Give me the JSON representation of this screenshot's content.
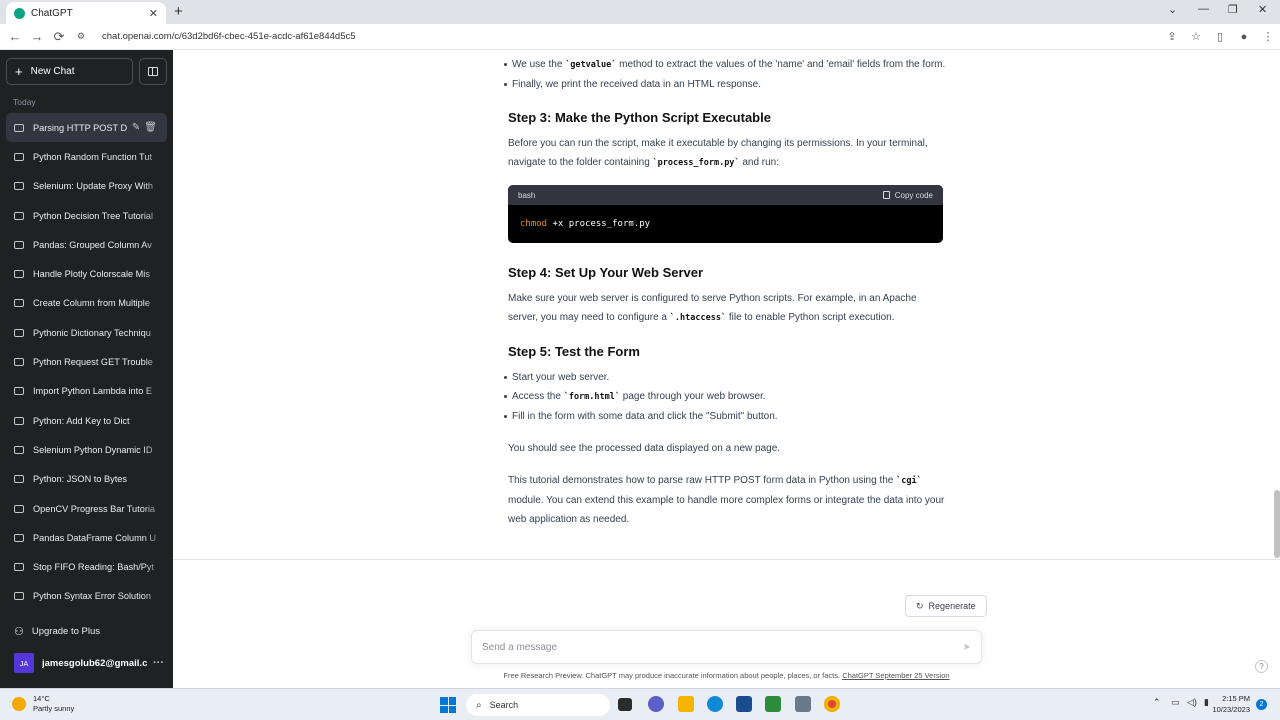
{
  "browser": {
    "tab_title": "ChatGPT",
    "tab_close": "✕",
    "new_tab": "+",
    "url": "chat.openai.com/c/63d2bd6f-cbec-451e-acdc-af61e844d5c5",
    "back": "←",
    "forward": "→",
    "reload": "⟳",
    "win_dropdown": "⌄",
    "win_minimize": "—",
    "win_maximize": "❐",
    "win_close": "✕"
  },
  "sidebar": {
    "new_chat_label": "New Chat",
    "section_label": "Today",
    "items": [
      {
        "label": "Parsing HTTP POST D"
      },
      {
        "label": "Python Random Function Tut"
      },
      {
        "label": "Selenium: Update Proxy With"
      },
      {
        "label": "Python Decision Tree Tutorial"
      },
      {
        "label": "Pandas: Grouped Column Av"
      },
      {
        "label": "Handle Plotly Colorscale Mis"
      },
      {
        "label": "Create Column from Multiple"
      },
      {
        "label": "Pythonic Dictionary Techniqu"
      },
      {
        "label": "Python Request GET Trouble"
      },
      {
        "label": "Import Python Lambda into E"
      },
      {
        "label": "Python: Add Key to Dict"
      },
      {
        "label": "Selenium Python Dynamic ID"
      },
      {
        "label": "Python: JSON to Bytes"
      },
      {
        "label": "OpenCV Progress Bar Tutoria"
      },
      {
        "label": "Pandas DataFrame Column U"
      },
      {
        "label": "Stop FIFO Reading: Bash/Pyt"
      },
      {
        "label": "Python Syntax Error Solution"
      }
    ],
    "upgrade_label": "Upgrade to Plus",
    "user_initials": "JA",
    "user_email": "jamesgolub62@gmail.c",
    "more": "···"
  },
  "content": {
    "bullet1_a": "We use the ",
    "bullet1_code": "`getvalue`",
    "bullet1_b": " method to extract the values of the 'name' and 'email' fields from the form.",
    "bullet2": "Finally, we print the received data in an HTML response.",
    "step3_title": "Step 3: Make the Python Script Executable",
    "step3_text_a": "Before you can run the script, make it executable by changing its permissions. In your terminal, navigate to the folder containing ",
    "step3_code": "`process_form.py`",
    "step3_text_b": " and run:",
    "code_lang": "bash",
    "copy_label": "Copy code",
    "code_cmd": "chmod",
    "code_rest": " +x process_form.py",
    "step4_title": "Step 4: Set Up Your Web Server",
    "step4_text_a": "Make sure your web server is configured to serve Python scripts. For example, in an Apache server, you may need to configure a ",
    "step4_code": "`.htaccess`",
    "step4_text_b": " file to enable Python script execution.",
    "step5_title": "Step 5: Test the Form",
    "step5_b1": "Start your web server.",
    "step5_b2_a": "Access the ",
    "step5_b2_code": "`form.html`",
    "step5_b2_b": " page through your web browser.",
    "step5_b3": "Fill in the form with some data and click the \"Submit\" button.",
    "result_text": "You should see the processed data displayed on a new page.",
    "summary_a": "This tutorial demonstrates how to parse raw HTTP POST form data in Python using the ",
    "summary_code": "`cgi`",
    "summary_b": " module. You can extend this example to handle more complex forms or integrate the data into your web application as needed."
  },
  "composer": {
    "regenerate_label": "Regenerate",
    "placeholder": "Send a message",
    "footer_text": "Free Research Preview. ChatGPT may produce inaccurate information about people, places, or facts. ",
    "footer_link": "ChatGPT September 25 Version",
    "help": "?"
  },
  "taskbar": {
    "temp": "14°C",
    "weather": "Partly sunny",
    "search_label": "Search",
    "time": "2:15 PM",
    "date": "10/23/2023",
    "notifications": "2"
  },
  "colors": {
    "sidebar_bg": "#202123",
    "accent": "#10a37f",
    "avatar": "#5436da"
  }
}
